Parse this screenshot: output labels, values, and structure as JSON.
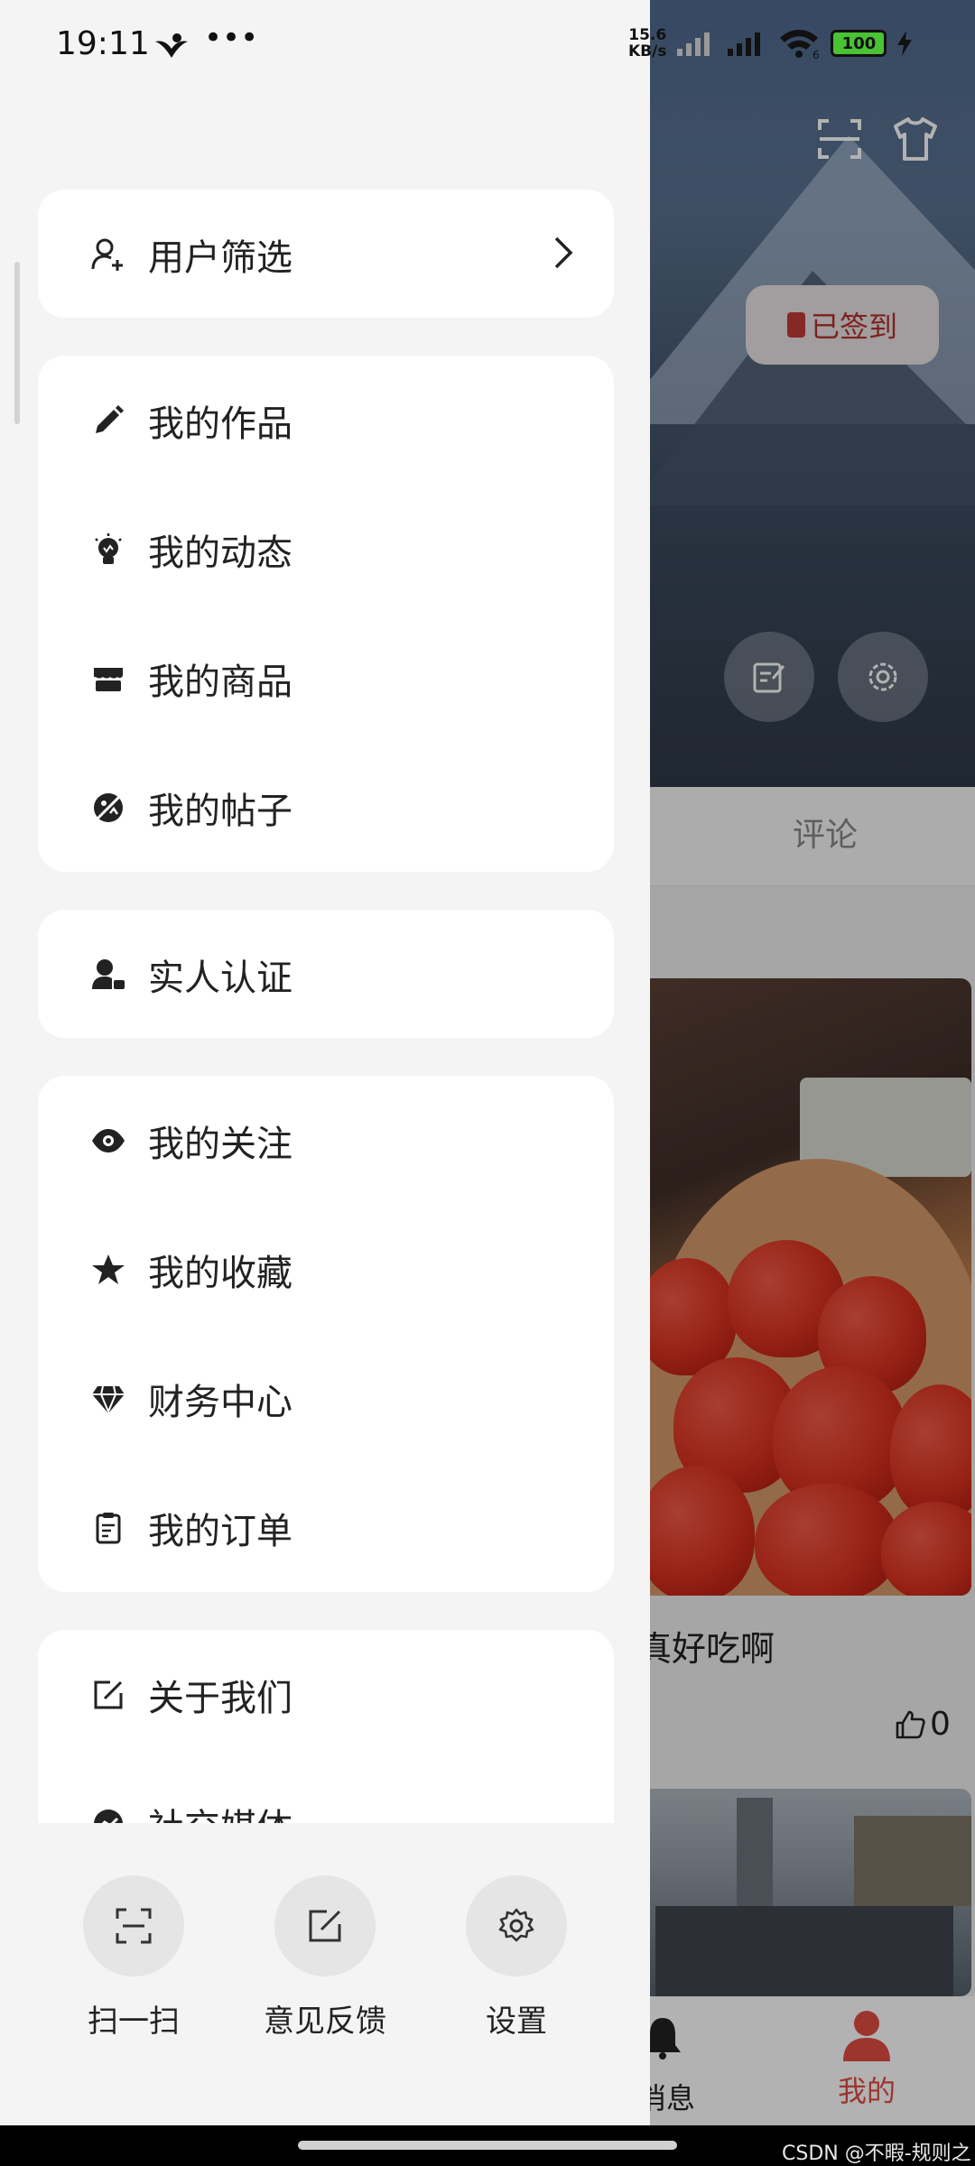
{
  "status_bar": {
    "time": "19:11",
    "net_speed_value": "15.6",
    "net_speed_unit": "KB/s",
    "battery": "100",
    "wifi_badge": "6"
  },
  "background": {
    "signed_in_label": "已签到",
    "tab_comment": "评论",
    "post_title": "真好吃啊",
    "like_count": "0",
    "nav_messages_label": "消息",
    "nav_me_label": "我的",
    "accent_color": "#e14c44"
  },
  "drawer": {
    "user_filter": {
      "label": "用户筛选",
      "icon": "user-add-icon"
    },
    "group1": [
      {
        "label": "我的作品",
        "icon": "pencil-icon"
      },
      {
        "label": "我的动态",
        "icon": "lightbulb-icon"
      },
      {
        "label": "我的商品",
        "icon": "store-icon"
      },
      {
        "label": "我的帖子",
        "icon": "no-image-icon"
      }
    ],
    "verify": {
      "label": "实人认证",
      "icon": "user-verified-icon"
    },
    "group3": [
      {
        "label": "我的关注",
        "icon": "eye-icon"
      },
      {
        "label": "我的收藏",
        "icon": "star-icon"
      },
      {
        "label": "财务中心",
        "icon": "diamond-icon"
      },
      {
        "label": "我的订单",
        "icon": "clipboard-icon"
      }
    ],
    "group4": [
      {
        "label": "关于我们",
        "icon": "edit-square-icon"
      },
      {
        "label": "社交媒体",
        "icon": "social-icon"
      }
    ],
    "actions": [
      {
        "label": "扫一扫",
        "icon": "scan-icon"
      },
      {
        "label": "意见反馈",
        "icon": "feedback-icon"
      },
      {
        "label": "设置",
        "icon": "gear-icon"
      }
    ]
  },
  "watermark": "CSDN @不暇-规则之树"
}
